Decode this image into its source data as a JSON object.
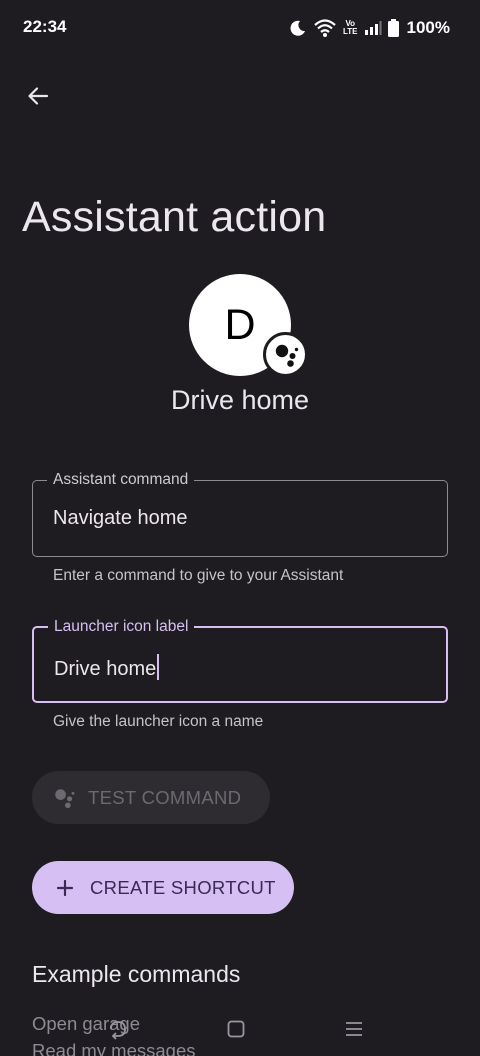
{
  "status_bar": {
    "time": "22:34",
    "volte_top": "Vo",
    "volte_bottom": "LTE",
    "battery": "100%"
  },
  "header": {
    "back_icon": "arrow-left-icon",
    "title": "Assistant action"
  },
  "shortcut": {
    "avatar_letter": "D",
    "badge_icon": "google-assistant-icon",
    "name": "Drive home"
  },
  "fields": {
    "command": {
      "label": "Assistant command",
      "value": "Navigate home",
      "helper": "Enter a command to give to your Assistant"
    },
    "launcher": {
      "label": "Launcher icon label",
      "value": "Drive home",
      "helper": "Give the launcher icon a name"
    }
  },
  "buttons": {
    "test": "TEST COMMAND",
    "create": "CREATE SHORTCUT"
  },
  "examples": {
    "heading": "Example commands",
    "items": [
      "Open garage",
      "Read my messages"
    ]
  },
  "colors": {
    "background": "#1f1c21",
    "accent": "#d6bff2",
    "accent_text": "#3b2a57"
  }
}
